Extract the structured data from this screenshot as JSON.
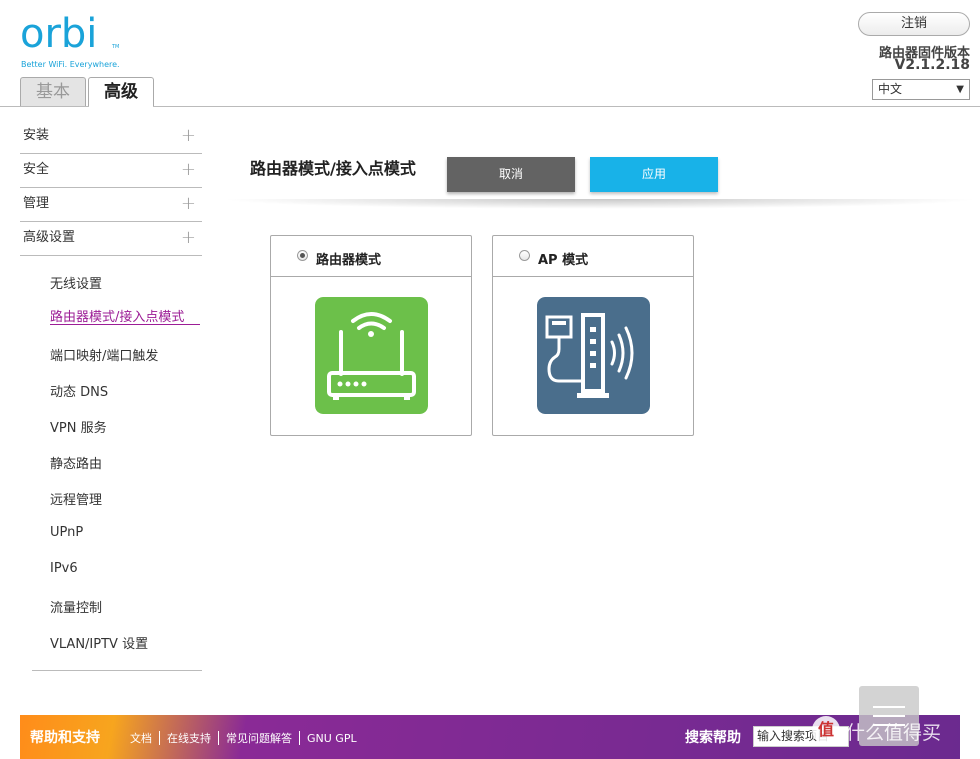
{
  "brand": {
    "logo": "orbi",
    "tm": "TM",
    "tagline": "Better WiFi. Everywhere."
  },
  "tabs": [
    {
      "label": "基本"
    },
    {
      "label": "高级"
    }
  ],
  "header": {
    "logout": "注销",
    "fw_label": "路由器固件版本",
    "fw_version": "V2.1.2.18",
    "language": "中文"
  },
  "sidebar": {
    "categories": [
      {
        "label": "安装"
      },
      {
        "label": "安全"
      },
      {
        "label": "管理"
      },
      {
        "label": "高级设置"
      }
    ],
    "items": [
      {
        "label": "无线设置"
      },
      {
        "label": "路由器模式/接入点模式"
      },
      {
        "label": "端口映射/端口触发"
      },
      {
        "label": "动态 DNS"
      },
      {
        "label": "VPN 服务"
      },
      {
        "label": "静态路由"
      },
      {
        "label": "远程管理"
      },
      {
        "label": "UPnP"
      },
      {
        "label": "IPv6"
      },
      {
        "label": "流量控制"
      },
      {
        "label": "VLAN/IPTV 设置"
      }
    ],
    "active_item": "路由器模式/接入点模式"
  },
  "main": {
    "title": "路由器模式/接入点模式",
    "cancel_label": "取消",
    "apply_label": "应用",
    "modes": [
      {
        "label": "路由器模式",
        "selected": true,
        "color": "#6cc04a"
      },
      {
        "label": "AP 模式",
        "selected": false,
        "color": "#4a6e8c"
      }
    ]
  },
  "footer": {
    "help_title": "帮助和支持",
    "links": [
      "文档",
      "在线支持",
      "常见问题解答",
      "GNU GPL"
    ],
    "search_label": "搜索帮助",
    "search_placeholder": "输入搜索项目"
  },
  "watermark": {
    "icon": "值",
    "text": "什么值得买"
  },
  "colors": {
    "accent": "#18b2e8",
    "active": "#9c1d96",
    "logo": "#1aa3d9"
  }
}
